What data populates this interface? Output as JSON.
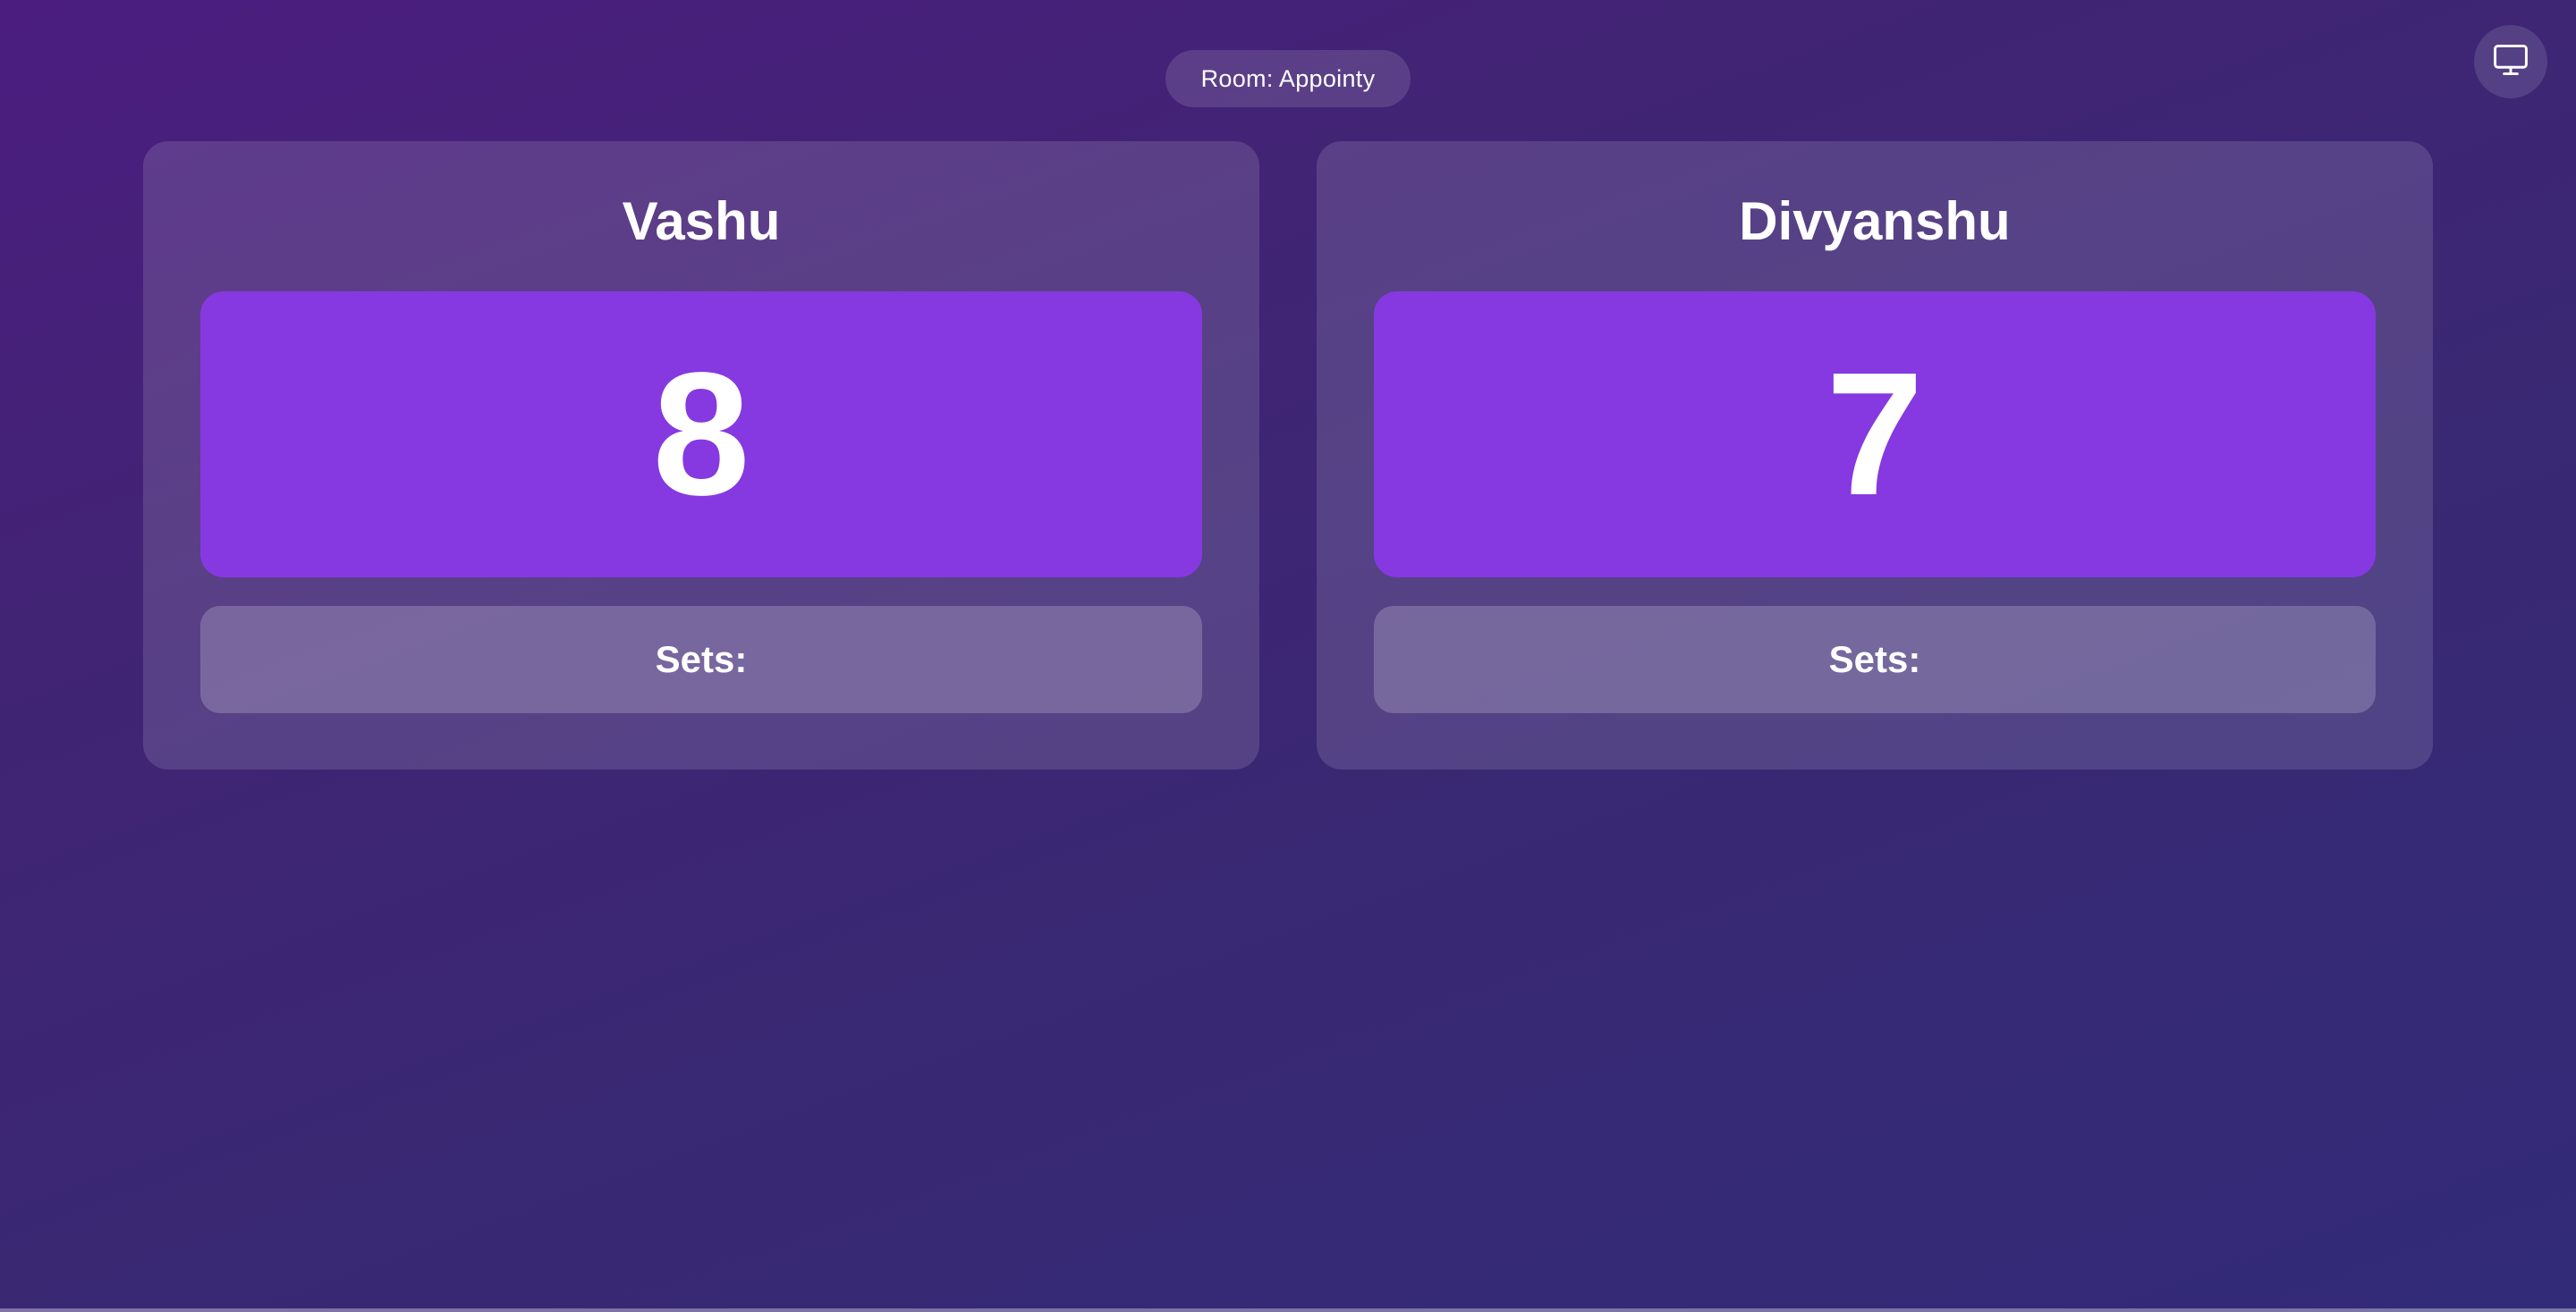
{
  "header": {
    "room_label": "Room: Appointy"
  },
  "toolbar": {
    "display_icon": "monitor-icon"
  },
  "players": [
    {
      "name": "Vashu",
      "score": "8",
      "sets_label": "Sets:"
    },
    {
      "name": "Divyanshu",
      "score": "7",
      "sets_label": "Sets:"
    }
  ],
  "colors": {
    "score_box": "#8639e0",
    "background_start": "#4b1d7f",
    "background_end": "#322b78"
  }
}
